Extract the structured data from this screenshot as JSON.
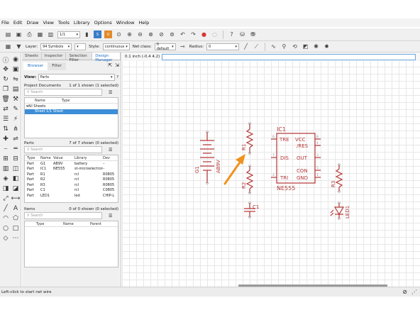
{
  "menu": [
    "File",
    "Edit",
    "Draw",
    "View",
    "Tools",
    "Library",
    "Options",
    "Window",
    "Help"
  ],
  "toolbar1": {
    "sheet_value": "1/1"
  },
  "toolbar2": {
    "layer_label": "Layer:",
    "layer_value": "94 Symbols",
    "style_label": "Style:",
    "style_value": "continuous",
    "netclass_label": "Net class:",
    "netclass_value": "0 default",
    "radius_label": "Radius:",
    "radius_value": "0"
  },
  "panel": {
    "tabs": [
      "Sheets",
      "Inspector",
      "Selection Filter",
      "Design Manager"
    ],
    "subtabs": [
      "Browser",
      "Filter"
    ],
    "view_label": "View:",
    "view_value": "Parts",
    "project_documents": {
      "title": "Project Documents",
      "count": "1 of 1 shown (1 selected)",
      "search_placeholder": "Search",
      "headers": [
        "Name",
        "Type"
      ],
      "rows": [
        "All Sheets",
        "Sheet 1/1   Sheet"
      ]
    },
    "parts": {
      "title": "Parts",
      "count": "7 of 7 shown (0 selected)",
      "search_placeholder": "Search",
      "headers": [
        "Type",
        "Name",
        "Value",
        "Library",
        "Dev"
      ],
      "rows": [
        [
          "Part",
          "G1",
          "AB9V",
          "battery",
          "–"
        ],
        [
          "Part",
          "IC1",
          "NE555",
          "st-microelectronics",
          "–"
        ],
        [
          "Part",
          "R1",
          "",
          "rcl",
          "R0805"
        ],
        [
          "Part",
          "R2",
          "",
          "rcl",
          "R0805"
        ],
        [
          "Part",
          "R3",
          "",
          "rcl",
          "R0805"
        ],
        [
          "Part",
          "C1",
          "",
          "rcl",
          "C0805"
        ],
        [
          "Part",
          "LED1",
          "",
          "led",
          "CHIP-L"
        ]
      ]
    },
    "items": {
      "title": "Items",
      "count": "0 of 0 shown (0 selected)",
      "search_placeholder": "Search",
      "headers": [
        "Type",
        "Name",
        "Parent"
      ]
    }
  },
  "coordinate_readout": "0.1 inch (-0.4 4.2)",
  "schematic": {
    "battery": {
      "name": "G1",
      "value": "AB9V"
    },
    "r1": "R1",
    "r2": "R2",
    "r3": "R3",
    "c1": "C1",
    "led": "LED1",
    "ic": {
      "name": "IC1",
      "value": "NE555",
      "pins": [
        "TRE",
        "VCC",
        "/RES",
        "DIS",
        "OUT",
        "TRI",
        "CON",
        "GND"
      ],
      "pin_numbers": [
        "6",
        "8",
        "4",
        "7",
        "3",
        "2",
        "5",
        "1"
      ]
    }
  },
  "status_text": "Left-click to start net wire",
  "colors": {
    "schematic": "#b53636",
    "arrow": "#f0921e",
    "selection": "#3d8ed6"
  }
}
